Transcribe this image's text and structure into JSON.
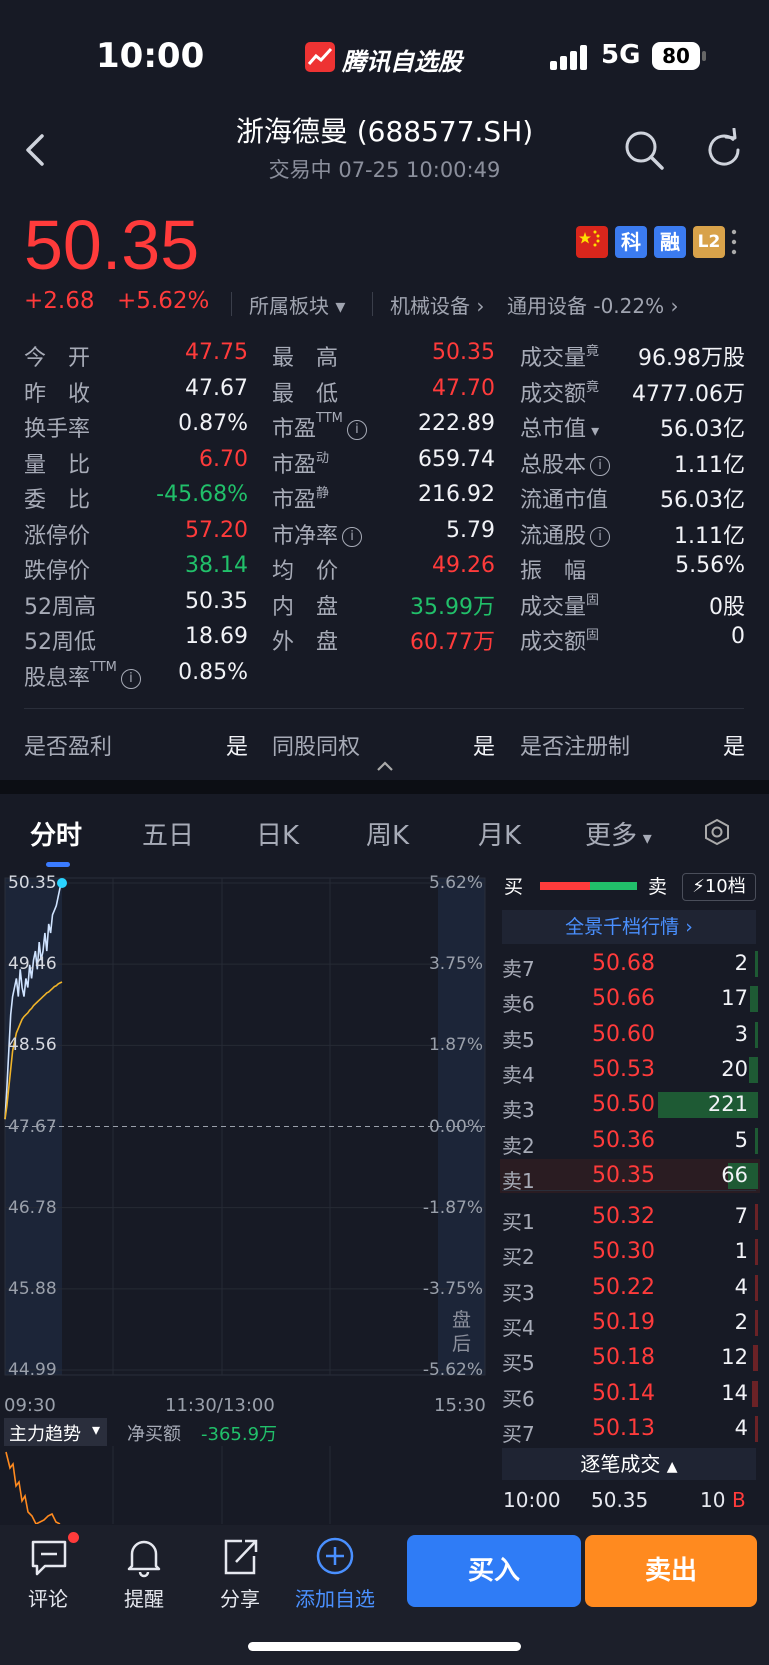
{
  "status": {
    "time": "10:00",
    "brand": "腾讯自选股",
    "network": "5G",
    "battery": "80"
  },
  "header": {
    "title": "浙海德曼 (688577.SH)",
    "subtitle": "交易中   07-25 10:00:49"
  },
  "quote": {
    "price": "50.35",
    "change": "+2.68",
    "change_pct": "+5.62%",
    "badges": [
      "科",
      "融",
      "L2"
    ],
    "sector_label": "所属板块",
    "sector1": "机械设备",
    "sector2": "通用设备 -0.22%"
  },
  "stats": {
    "col1": [
      {
        "label": "今　开",
        "value": "47.75",
        "color": "red"
      },
      {
        "label": "昨　收",
        "value": "47.67",
        "color": "white"
      },
      {
        "label": "换手率",
        "value": "0.87%",
        "color": "white"
      },
      {
        "label": "量　比",
        "value": "6.70",
        "color": "red"
      },
      {
        "label": "委　比",
        "value": "-45.68%",
        "color": "green"
      },
      {
        "label": "涨停价",
        "value": "57.20",
        "color": "red"
      },
      {
        "label": "跌停价",
        "value": "38.14",
        "color": "green"
      },
      {
        "label": "52周高",
        "value": "50.35",
        "color": "white"
      },
      {
        "label": "52周低",
        "value": "18.69",
        "color": "white"
      },
      {
        "label": "股息率",
        "value": "0.85%",
        "color": "white"
      }
    ],
    "col2": [
      {
        "label": "最　高",
        "value": "50.35",
        "color": "red"
      },
      {
        "label": "最　低",
        "value": "47.70",
        "color": "red"
      },
      {
        "label": "市盈",
        "value": "222.89",
        "color": "white"
      },
      {
        "label": "市盈",
        "value": "659.74",
        "color": "white"
      },
      {
        "label": "市盈",
        "value": "216.92",
        "color": "white"
      },
      {
        "label": "市净率",
        "value": "5.79",
        "color": "white"
      },
      {
        "label": "均　价",
        "value": "49.26",
        "color": "red"
      },
      {
        "label": "内　盘",
        "value": "35.99万",
        "color": "green"
      },
      {
        "label": "外　盘",
        "value": "60.77万",
        "color": "red"
      }
    ],
    "col3": [
      {
        "label": "成交量",
        "value": "96.98万股"
      },
      {
        "label": "成交额",
        "value": "4777.06万"
      },
      {
        "label": "总市值",
        "value": "56.03亿"
      },
      {
        "label": "总股本",
        "value": "1.11亿"
      },
      {
        "label": "流通市值",
        "value": "56.03亿"
      },
      {
        "label": "流通股",
        "value": "1.11亿"
      },
      {
        "label": "振　幅",
        "value": "5.56%"
      },
      {
        "label": "成交量",
        "value": "0股"
      },
      {
        "label": "成交额",
        "value": "0"
      }
    ],
    "sup_ttm": "TTM",
    "sup_dyn": "动",
    "sup_static": "静",
    "sup_jing": "竟",
    "sup_gu": "固",
    "info_i": "i"
  },
  "flags": [
    {
      "label": "是否盈利",
      "value": "是"
    },
    {
      "label": "同股同权",
      "value": "是"
    },
    {
      "label": "是否注册制",
      "value": "是"
    }
  ],
  "tabs": [
    "分时",
    "五日",
    "日K",
    "周K",
    "月K",
    "更多"
  ],
  "chart": {
    "left_labels": [
      "50.35",
      "49.46",
      "48.56",
      "47.67",
      "46.78",
      "45.88",
      "44.99"
    ],
    "right_labels": [
      "5.62%",
      "3.75%",
      "1.87%",
      "0.00%",
      "-1.87%",
      "-3.75%",
      "-5.62%"
    ],
    "time_labels": [
      "09:30",
      "11:30/13:00",
      "15:30"
    ],
    "after_hours": "盘后",
    "indicator": "主力趋势",
    "net_buy_label": "净买额",
    "net_buy_value": "-365.9万",
    "colors": {
      "price": "#cfe3ff",
      "avg": "#f0b429",
      "last": "#2ad3ff",
      "mainflow": "#ff8a1f"
    }
  },
  "chart_data": {
    "type": "line",
    "x": [
      "09:30",
      "09:31",
      "09:32",
      "09:33",
      "09:34",
      "09:35",
      "09:36",
      "09:37",
      "09:38",
      "09:39",
      "09:40",
      "09:41",
      "09:42",
      "09:43",
      "09:44",
      "09:45",
      "09:46",
      "09:47",
      "09:48",
      "09:49",
      "09:50",
      "09:51",
      "09:52",
      "09:53",
      "09:54",
      "09:55",
      "09:56",
      "09:57",
      "09:58",
      "09:59",
      "10:00"
    ],
    "series": [
      {
        "values": [
          47.75,
          48.1,
          48.5,
          48.9,
          49.1,
          49.2,
          49.3,
          49.1,
          49.4,
          49.2,
          49.1,
          49.3,
          49.2,
          49.45,
          49.3,
          49.5,
          49.6,
          49.4,
          49.7,
          49.5,
          49.6,
          49.8,
          49.6,
          49.9,
          49.8,
          50.0,
          50.05,
          50.1,
          50.2,
          50.3,
          50.35
        ]
      },
      {
        "values": [
          47.75,
          47.9,
          48.1,
          48.3,
          48.5,
          48.6,
          48.7,
          48.75,
          48.8,
          48.85,
          48.88,
          48.9,
          48.92,
          48.95,
          48.97,
          49.0,
          49.02,
          49.04,
          49.06,
          49.08,
          49.1,
          49.12,
          49.14,
          49.15,
          49.17,
          49.19,
          49.21,
          49.22,
          49.24,
          49.25,
          49.26
        ]
      }
    ],
    "ylim": [
      44.99,
      50.35
    ]
  },
  "orderbook": {
    "header_buy": "买",
    "header_sell": "卖",
    "depth_label": "10档",
    "panorama": "全景千档行情",
    "asks": [
      {
        "label": "卖7",
        "price": "50.68",
        "vol": "2",
        "bar": 0.01
      },
      {
        "label": "卖6",
        "price": "50.66",
        "vol": "17",
        "bar": 0.08
      },
      {
        "label": "卖5",
        "price": "50.60",
        "vol": "3",
        "bar": 0.01
      },
      {
        "label": "卖4",
        "price": "50.53",
        "vol": "20",
        "bar": 0.09
      },
      {
        "label": "卖3",
        "price": "50.50",
        "vol": "221",
        "bar": 1.0
      },
      {
        "label": "卖2",
        "price": "50.36",
        "vol": "5",
        "bar": 0.02
      },
      {
        "label": "卖1",
        "price": "50.35",
        "vol": "66",
        "bar": 0.3
      }
    ],
    "bids": [
      {
        "label": "买1",
        "price": "50.32",
        "vol": "7",
        "bar": 0.03
      },
      {
        "label": "买2",
        "price": "50.30",
        "vol": "1",
        "bar": 0.005
      },
      {
        "label": "买3",
        "price": "50.22",
        "vol": "4",
        "bar": 0.02
      },
      {
        "label": "买4",
        "price": "50.19",
        "vol": "2",
        "bar": 0.01
      },
      {
        "label": "买5",
        "price": "50.18",
        "vol": "12",
        "bar": 0.05
      },
      {
        "label": "买6",
        "price": "50.14",
        "vol": "14",
        "bar": 0.06
      },
      {
        "label": "买7",
        "price": "50.13",
        "vol": "4",
        "bar": 0.02
      }
    ],
    "tick_label": "逐笔成交",
    "last_trade": {
      "time": "10:00",
      "price": "50.35",
      "vol": "10",
      "side": "B"
    }
  },
  "nav": {
    "items": [
      "评论",
      "提醒",
      "分享",
      "添加自选"
    ],
    "buy": "买入",
    "sell": "卖出"
  }
}
